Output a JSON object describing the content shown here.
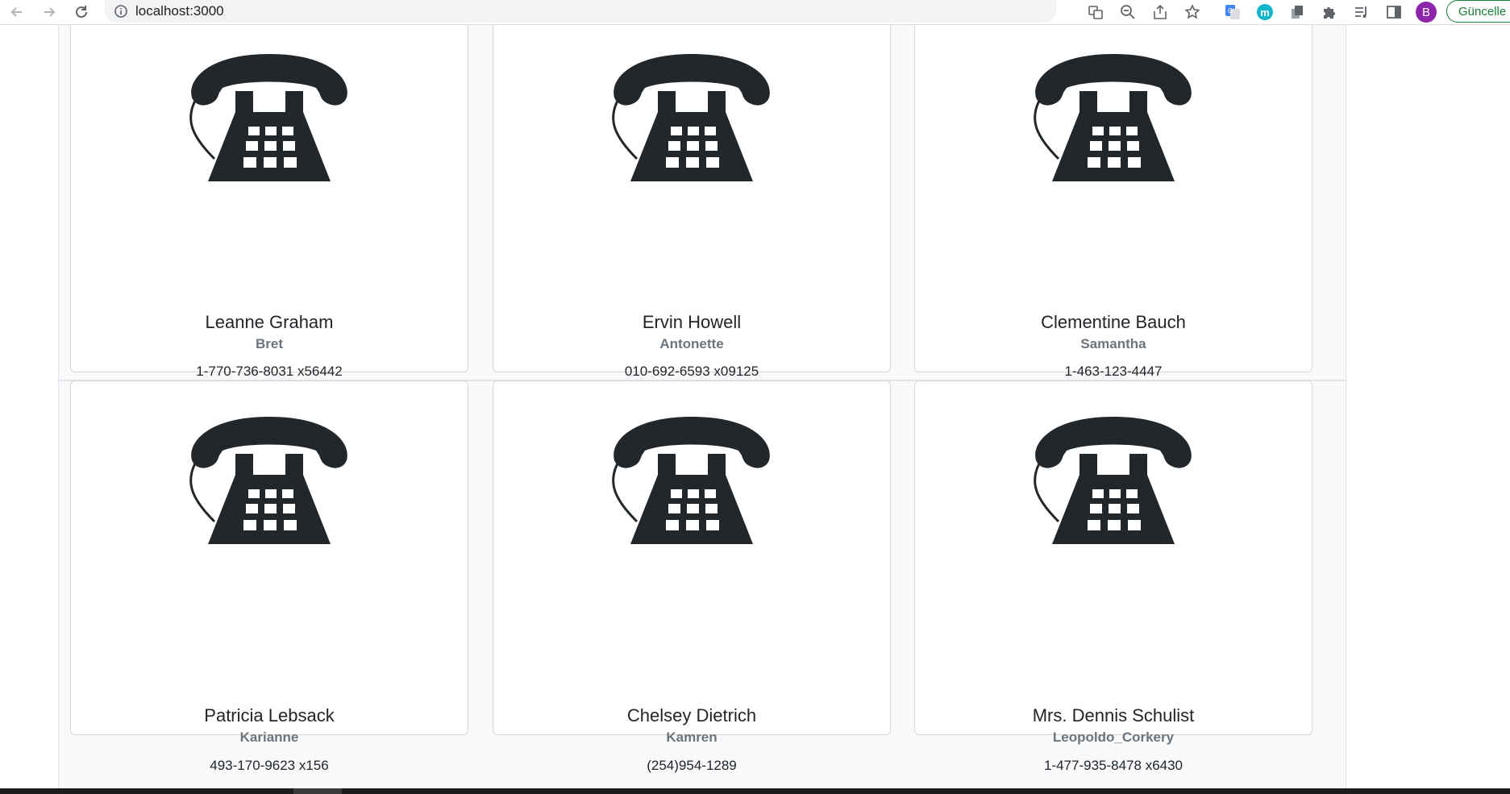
{
  "browser": {
    "url": "localhost:3000",
    "update_label": "Güncelle",
    "profile_initial": "B",
    "extension_letter": "m",
    "icons": [
      "back-icon",
      "forward-icon",
      "reload-icon",
      "info-icon",
      "translate-icon",
      "zoom-out-icon",
      "share-icon",
      "star-icon",
      "google-translate-icon",
      "extension-m-icon",
      "copy-icon",
      "puzzle-icon",
      "reading-list-icon",
      "side-panel-icon"
    ]
  },
  "theme": {
    "text": "#212529",
    "muted": "#6c757d",
    "icon_fill": "#22272b",
    "profile": "#8e24aa",
    "extension": "#12b5cb",
    "update": "#188038"
  },
  "cards": [
    {
      "name": "Leanne Graham",
      "username": "Bret",
      "phone": "1-770-736-8031 x56442",
      "icon": "telephone-icon"
    },
    {
      "name": "Ervin Howell",
      "username": "Antonette",
      "phone": "010-692-6593 x09125",
      "icon": "telephone-icon"
    },
    {
      "name": "Clementine Bauch",
      "username": "Samantha",
      "phone": "1-463-123-4447",
      "icon": "telephone-icon"
    },
    {
      "name": "Patricia Lebsack",
      "username": "Karianne",
      "phone": "493-170-9623 x156",
      "icon": "telephone-icon"
    },
    {
      "name": "Chelsey Dietrich",
      "username": "Kamren",
      "phone": "(254)954-1289",
      "icon": "telephone-icon"
    },
    {
      "name": "Mrs. Dennis Schulist",
      "username": "Leopoldo_Corkery",
      "phone": "1-477-935-8478 x6430",
      "icon": "telephone-icon"
    }
  ]
}
